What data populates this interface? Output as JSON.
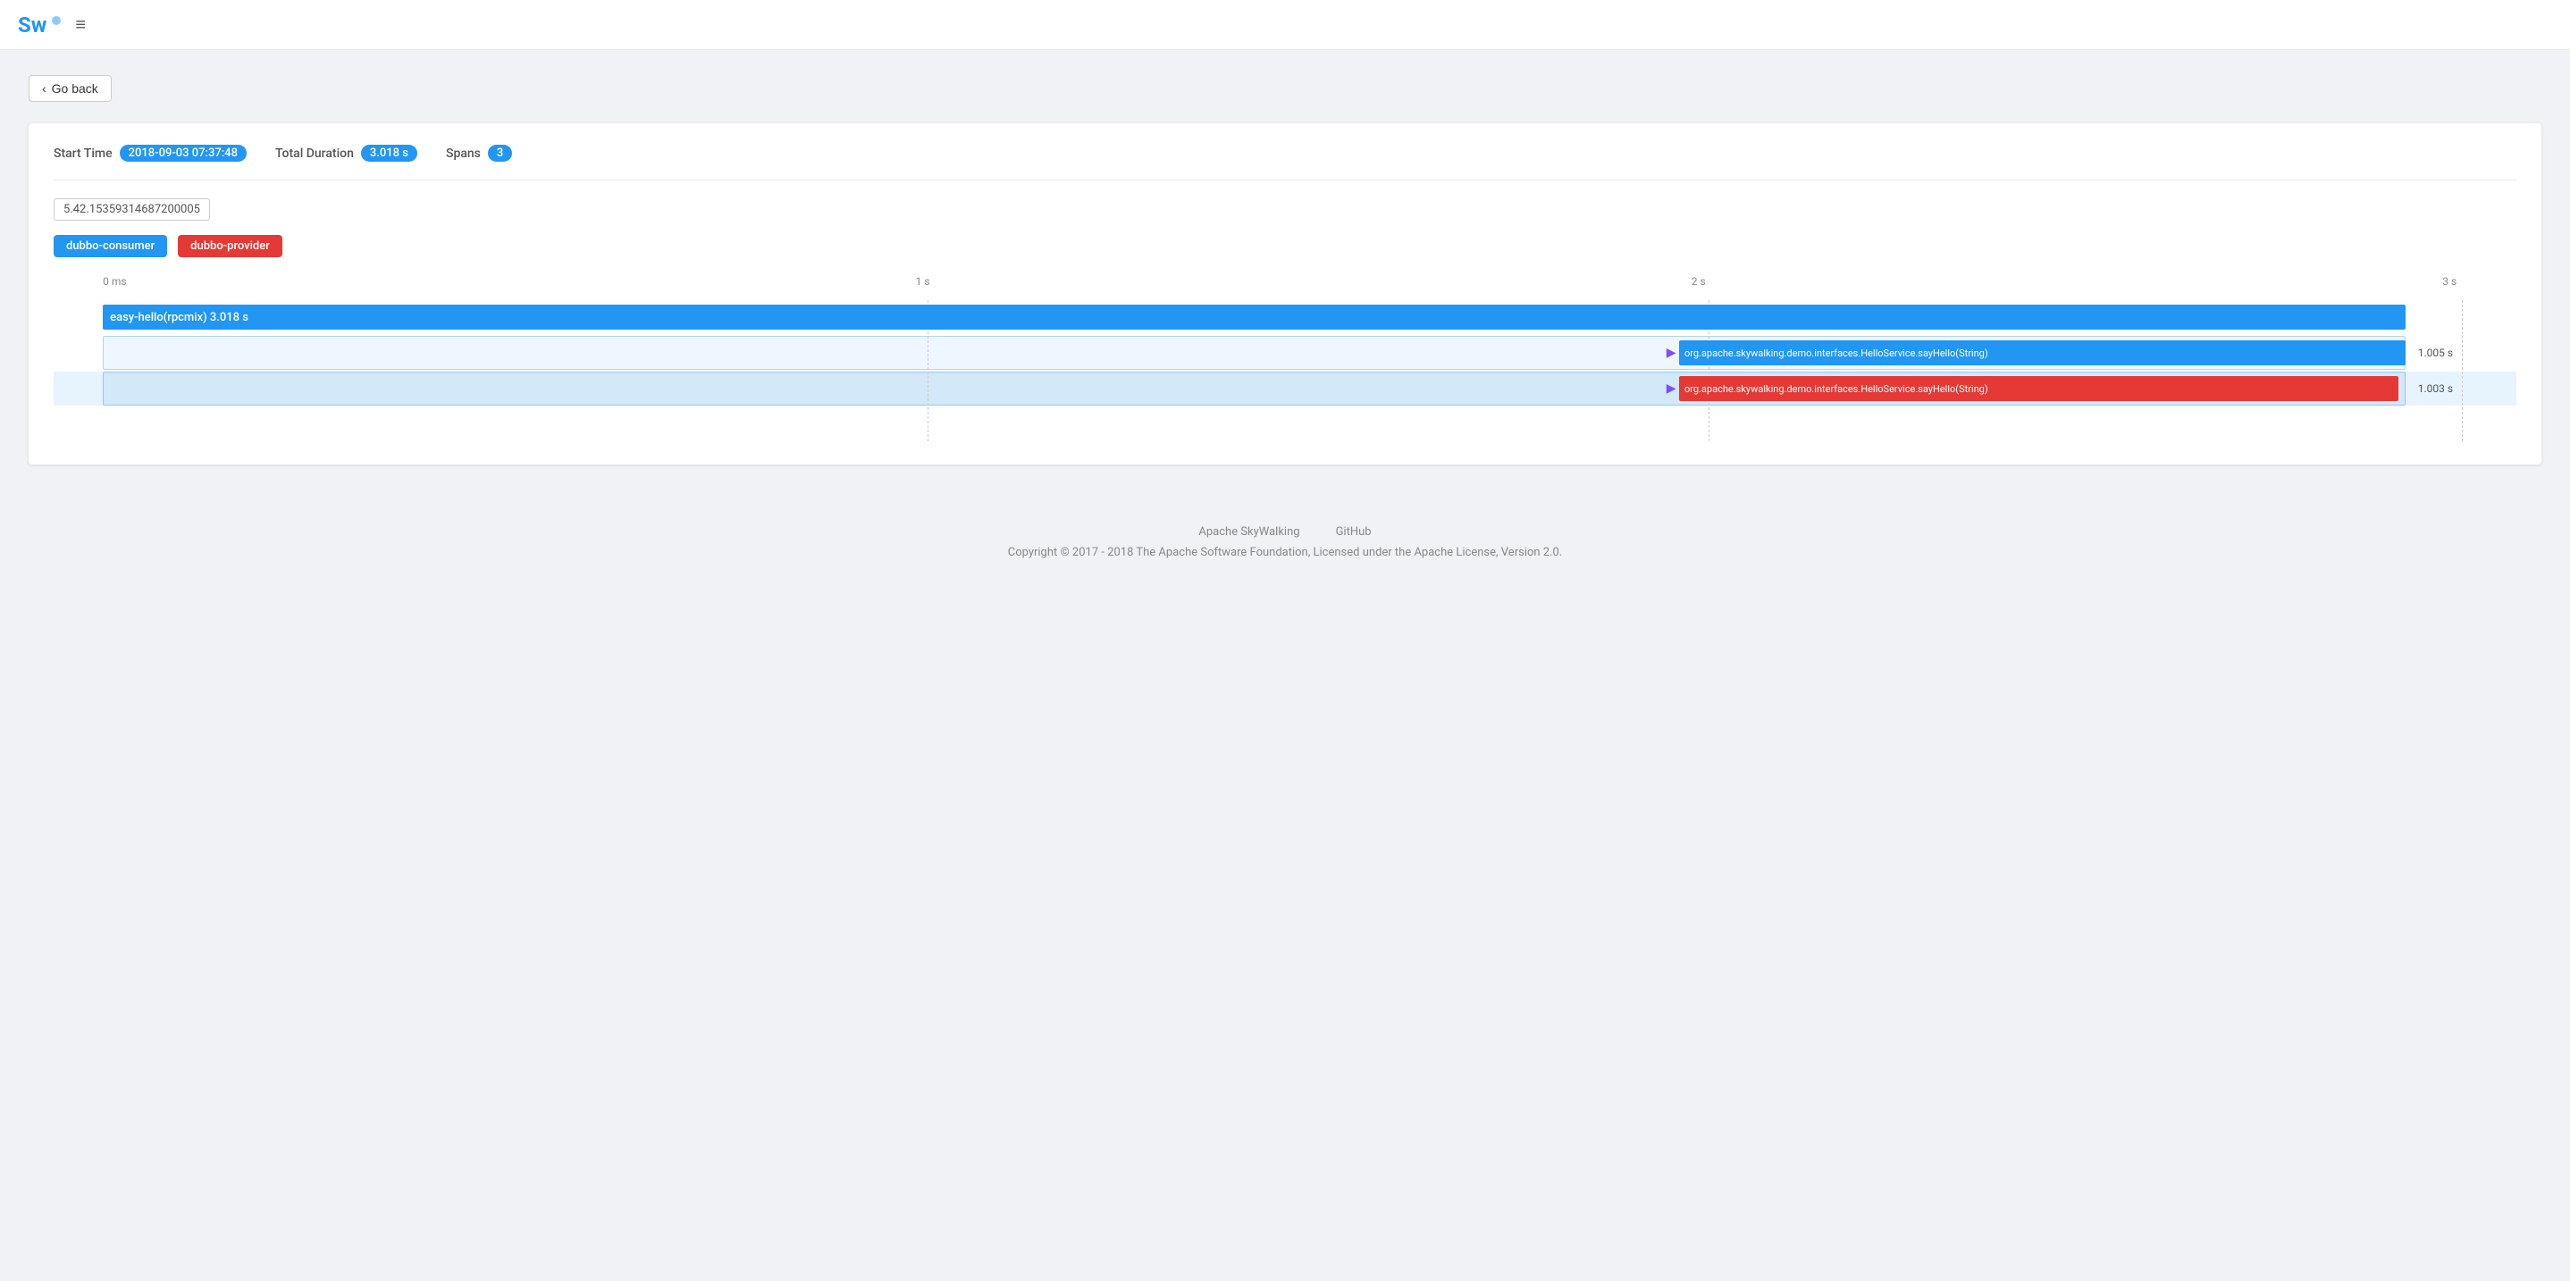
{
  "header": {
    "logo_text": "Sw",
    "menu_icon": "≡"
  },
  "go_back_button": "Go back",
  "trace": {
    "start_time_label": "Start Time",
    "start_time_value": "2018-09-03 07:37:48",
    "total_duration_label": "Total Duration",
    "total_duration_value": "3.018 s",
    "spans_label": "Spans",
    "spans_count": "3",
    "trace_id": "5.42.15359314687200005",
    "legend": {
      "consumer_label": "dubbo-consumer",
      "provider_label": "dubbo-provider"
    },
    "time_marks": [
      "0 ms",
      "1 s",
      "2 s",
      "3 s"
    ],
    "spans": [
      {
        "id": "span-1",
        "label": "easy-hello(rpcmix) 3.018 s",
        "type": "blue",
        "left_pct": 2.2,
        "width_pct": 95.0,
        "duration": "",
        "has_arrow": false
      },
      {
        "id": "span-2",
        "label": "",
        "type": "light-blue",
        "left_pct": 2.2,
        "width_pct": 95.0,
        "duration": "",
        "has_arrow": true,
        "arrow_left_pct": 66.0,
        "sub_bar_left_pct": 66.0,
        "sub_bar_width_pct": 33.8,
        "sub_label": "org.apache.skywalking.demo.interfaces.HelloService.sayHello(String)",
        "sub_type": "blue",
        "sub_duration": "1.005 s"
      },
      {
        "id": "span-3",
        "label": "",
        "type": "light-blue",
        "left_pct": 2.2,
        "width_pct": 95.0,
        "duration": "",
        "has_arrow": true,
        "arrow_left_pct": 66.0,
        "sub_bar_left_pct": 66.0,
        "sub_bar_width_pct": 33.5,
        "sub_label": "org.apache.skywalking.demo.interfaces.HelloService.sayHello(String)",
        "sub_type": "red",
        "sub_duration": "1.003 s"
      }
    ]
  },
  "footer": {
    "links": [
      "Apache SkyWalking",
      "GitHub"
    ],
    "copyright": "Copyright © 2017 - 2018 The Apache Software Foundation, Licensed under the Apache License, Version 2.0."
  }
}
